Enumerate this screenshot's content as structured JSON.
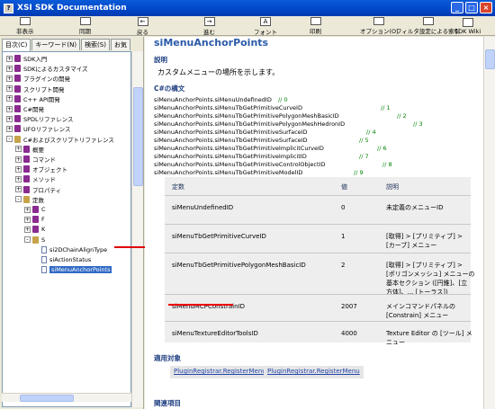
{
  "window": {
    "title": "XSI SDK Documentation"
  },
  "toolbar": {
    "buttons": [
      {
        "label": "非表示",
        "icon": "hide-icon"
      },
      {
        "label": "同期",
        "icon": "sync-icon"
      },
      {
        "label": "戻る",
        "icon": "back-icon"
      },
      {
        "label": "進む",
        "icon": "forward-icon"
      },
      {
        "label": "フォント",
        "icon": "font-icon"
      },
      {
        "label": "印刷",
        "icon": "print-icon"
      },
      {
        "label": "オプション(O)",
        "icon": "options-icon"
      },
      {
        "label": "フィルタ設定による索引",
        "icon": "filter-index-icon"
      },
      {
        "label": "SDK Wiki",
        "icon": "wiki-icon"
      }
    ]
  },
  "nav": {
    "tabs": [
      "目次(C)",
      "キーワード(N)",
      "検索(S)",
      "お気"
    ],
    "tree": [
      {
        "label": "SDK入門",
        "level": 0,
        "exp": "+",
        "icon": "book"
      },
      {
        "label": "SDKによるカスタマイズ",
        "level": 0,
        "exp": "+",
        "icon": "book"
      },
      {
        "label": "プラグインの開発",
        "level": 0,
        "exp": "+",
        "icon": "book"
      },
      {
        "label": "スクリプト開発",
        "level": 0,
        "exp": "+",
        "icon": "book"
      },
      {
        "label": "C++ API開発",
        "level": 0,
        "exp": "+",
        "icon": "book"
      },
      {
        "label": "C#開発",
        "level": 0,
        "exp": "+",
        "icon": "book"
      },
      {
        "label": "SPDLリファレンス",
        "level": 0,
        "exp": "+",
        "icon": "book"
      },
      {
        "label": "UFOリファレンス",
        "level": 0,
        "exp": "+",
        "icon": "book"
      },
      {
        "label": "C#およびスクリプトリファレンス",
        "level": 0,
        "exp": "-",
        "icon": "book-open"
      },
      {
        "label": "概要",
        "level": 1,
        "exp": "+",
        "icon": "book"
      },
      {
        "label": "コマンド",
        "level": 1,
        "exp": "+",
        "icon": "book"
      },
      {
        "label": "オブジェクト",
        "level": 1,
        "exp": "+",
        "icon": "book"
      },
      {
        "label": "メソッド",
        "level": 1,
        "exp": "+",
        "icon": "book"
      },
      {
        "label": "プロパティ",
        "level": 1,
        "exp": "+",
        "icon": "book"
      },
      {
        "label": "定数",
        "level": 1,
        "exp": "-",
        "icon": "book-open"
      },
      {
        "label": "C",
        "level": 2,
        "exp": "+",
        "icon": "book"
      },
      {
        "label": "F",
        "level": 2,
        "exp": "+",
        "icon": "book"
      },
      {
        "label": "K",
        "level": 2,
        "exp": "+",
        "icon": "book"
      },
      {
        "label": "S",
        "level": 2,
        "exp": "-",
        "icon": "book-open"
      },
      {
        "label": "si2DChainAlignType",
        "level": 3,
        "exp": "",
        "icon": "page"
      },
      {
        "label": "siActionStatus",
        "level": 3,
        "exp": "",
        "icon": "page"
      },
      {
        "label": "siMenuAnchorPoints",
        "level": 3,
        "exp": "",
        "icon": "page",
        "selected": true
      }
    ]
  },
  "content": {
    "title": "siMenuAnchorPoints",
    "desc_heading": "説明",
    "description": "カスタムメニューの場所を示します。",
    "syntax_heading": "C#の構文",
    "code": [
      {
        "text": "siMenuAnchorPoints.siMenuUndefinedID",
        "comment": "// 0"
      },
      {
        "text": "siMenuAnchorPoints.siMenuTbGetPrimitiveCurveID",
        "comment": "// 1"
      },
      {
        "text": "siMenuAnchorPoints.siMenuTbGetPrimitivePolygonMeshBasicID",
        "comment": "// 2"
      },
      {
        "text": "siMenuAnchorPoints.siMenuTbGetPrimitivePolygonMeshHedronID",
        "comment": "// 3"
      },
      {
        "text": "siMenuAnchorPoints.siMenuTbGetPrimitiveSurfaceID",
        "comment": "// 4"
      },
      {
        "text": "siMenuAnchorPoints.siMenuTbGetPrimitiveSurfaceID",
        "comment": "// 5"
      },
      {
        "text": "siMenuAnchorPoints.siMenuTbGetPrimitiveImplicitCurveID",
        "comment": "// 6"
      },
      {
        "text": "siMenuAnchorPoints.siMenuTbGetPrimitiveImplicitID",
        "comment": "// 7"
      },
      {
        "text": "siMenuAnchorPoints.siMenuTbGetPrimitiveControlObjectID",
        "comment": "// 8"
      },
      {
        "text": "siMenuAnchorPoints.siMenuTbGetPrimitiveModelID",
        "comment": "// 9"
      }
    ],
    "table": {
      "headers": [
        "定数",
        "値",
        "説明"
      ],
      "rows": [
        {
          "name": "siMenuUndefinedID",
          "value": "0",
          "desc": [
            "未定義のメニューID"
          ]
        },
        {
          "name": "siMenuTbGetPrimitiveCurveID",
          "value": "1",
          "desc": [
            "[取得] > [プリミティブ] >",
            "[カーブ] メニュー"
          ]
        },
        {
          "name": "siMenuTbGetPrimitivePolygonMeshBasicID",
          "value": "2",
          "desc": [
            "[取得] > [プリミティブ] >",
            "[ポリゴンメッシュ] メニューの",
            "基本セクション ([円錐]、[立",
            "方体]、... [トーラス])"
          ]
        },
        {
          "name": "siMenuMCPConstrainID",
          "value": "2007",
          "desc": [
            "メインコマンドパネルの",
            "[Constrain] メニュー"
          ]
        },
        {
          "name": "siMenuTextureEditorToolsID",
          "value": "4000",
          "desc": [
            "Texture Editor の [ツール] メ",
            "ニュー"
          ]
        }
      ]
    },
    "applies_heading": "適用対象",
    "applies_links": [
      "PluginRegistrar.RegisterMenu",
      "PluginRegistrar.RegisterMenu"
    ],
    "related_heading": "関連項目"
  },
  "colors": {
    "accent": "#2b5aa8",
    "annotation": "#e00000",
    "selection": "#316ac5"
  }
}
